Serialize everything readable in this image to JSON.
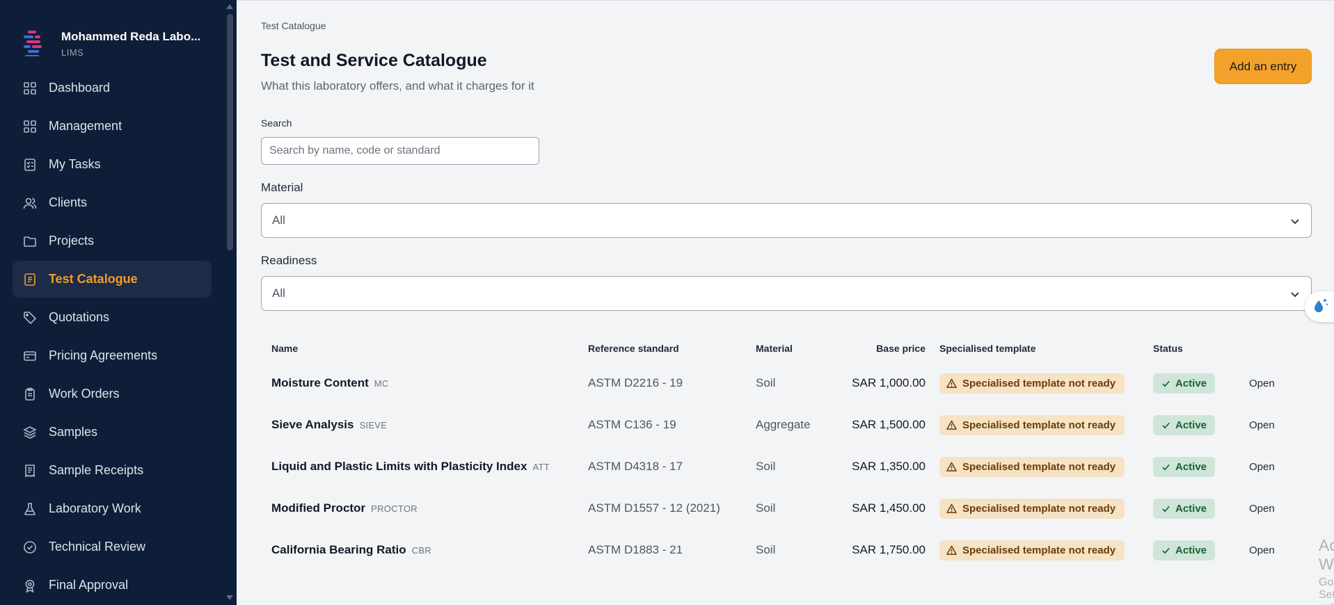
{
  "brand": {
    "lab_name": "Mohammed Reda Labo...",
    "subtitle": "LIMS"
  },
  "sidebar": {
    "items": [
      {
        "label": "Dashboard",
        "icon": "grid-icon",
        "active": false
      },
      {
        "label": "Management",
        "icon": "grid-icon",
        "active": false
      },
      {
        "label": "My Tasks",
        "icon": "checklist-icon",
        "active": false
      },
      {
        "label": "Clients",
        "icon": "users-icon",
        "active": false
      },
      {
        "label": "Projects",
        "icon": "folder-icon",
        "active": false
      },
      {
        "label": "Test Catalogue",
        "icon": "document-icon",
        "active": true
      },
      {
        "label": "Quotations",
        "icon": "tag-icon",
        "active": false
      },
      {
        "label": "Pricing Agreements",
        "icon": "card-icon",
        "active": false
      },
      {
        "label": "Work Orders",
        "icon": "clipboard-icon",
        "active": false
      },
      {
        "label": "Samples",
        "icon": "layers-icon",
        "active": false
      },
      {
        "label": "Sample Receipts",
        "icon": "receipt-icon",
        "active": false
      },
      {
        "label": "Laboratory Work",
        "icon": "flask-icon",
        "active": false
      },
      {
        "label": "Technical Review",
        "icon": "badge-check-icon",
        "active": false
      },
      {
        "label": "Final Approval",
        "icon": "award-icon",
        "active": false
      }
    ]
  },
  "page": {
    "breadcrumb": "Test Catalogue",
    "title": "Test and Service Catalogue",
    "subtitle": "What this laboratory offers, and what it charges for it",
    "add_button": "Add an entry"
  },
  "filters": {
    "search_label": "Search",
    "search_placeholder": "Search by name, code or standard",
    "material_label": "Material",
    "material_value": "All",
    "readiness_label": "Readiness",
    "readiness_value": "All"
  },
  "table": {
    "headers": {
      "name": "Name",
      "standard": "Reference standard",
      "material": "Material",
      "price": "Base price",
      "template": "Specialised template",
      "status": "Status"
    },
    "rows": [
      {
        "name": "Moisture Content",
        "code": "MC",
        "standard": "ASTM D2216 - 19",
        "material": "Soil",
        "price": "SAR 1,000.00",
        "template": "Specialised template not ready",
        "status": "Active",
        "action": "Open"
      },
      {
        "name": "Sieve Analysis",
        "code": "SIEVE",
        "standard": "ASTM C136 - 19",
        "material": "Aggregate",
        "price": "SAR 1,500.00",
        "template": "Specialised template not ready",
        "status": "Active",
        "action": "Open"
      },
      {
        "name": "Liquid and Plastic Limits with Plasticity Index",
        "code": "ATT",
        "standard": "ASTM D4318 - 17",
        "material": "Soil",
        "price": "SAR 1,350.00",
        "template": "Specialised template not ready",
        "status": "Active",
        "action": "Open"
      },
      {
        "name": "Modified Proctor",
        "code": "PROCTOR",
        "standard": "ASTM D1557 - 12 (2021)",
        "material": "Soil",
        "price": "SAR 1,450.00",
        "template": "Specialised template not ready",
        "status": "Active",
        "action": "Open"
      },
      {
        "name": "California Bearing Ratio",
        "code": "CBR",
        "standard": "ASTM D1883 - 21",
        "material": "Soil",
        "price": "SAR 1,750.00",
        "template": "Specialised template not ready",
        "status": "Active",
        "action": "Open"
      }
    ]
  },
  "watermark": {
    "line1": "Activate Windows",
    "line2": "Go to Settings to activate Windows."
  },
  "colors": {
    "sidebar_bg": "#0f1e38",
    "accent": "#f39c2a",
    "button": "#f2a22a",
    "template_badge": "#f6e2c4",
    "status_badge": "#cfe5d9"
  }
}
